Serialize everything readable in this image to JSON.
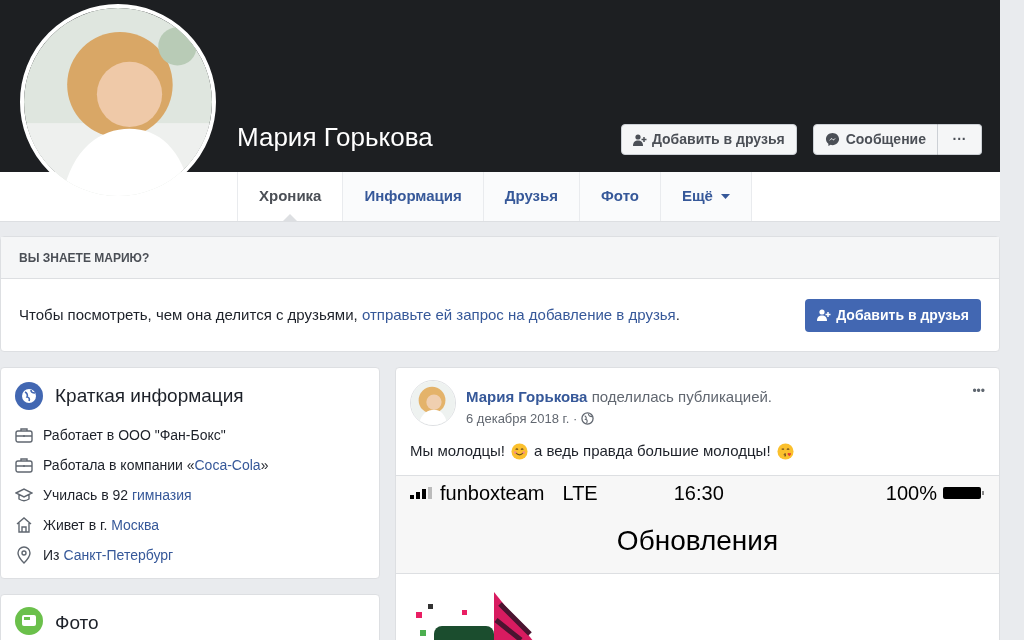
{
  "profile": {
    "name": "Мария Горькова",
    "add_friend": "Добавить в друзья",
    "message": "Сообщение",
    "more": "···"
  },
  "tabs": [
    {
      "label": "Хроника",
      "selected": true
    },
    {
      "label": "Информация",
      "selected": false
    },
    {
      "label": "Друзья",
      "selected": false
    },
    {
      "label": "Фото",
      "selected": false
    },
    {
      "label": "Ещё",
      "selected": false,
      "dropdown": true
    }
  ],
  "prompt": {
    "title": "ВЫ ЗНАЕТЕ МАРИЮ?",
    "text": "Чтобы посмотреть, чем она делится с друзьями,",
    "link": "отправьте ей запрос на добавление в друзья",
    "after": ".",
    "button": "Добавить в друзья"
  },
  "intro": {
    "title": "Краткая информация",
    "items": [
      {
        "kind": "work",
        "text": "Работает в ООО \"Фан-Бокс\""
      },
      {
        "kind": "work",
        "text": "Работала в компании «",
        "link": "Coca-Cola",
        "after": "»"
      },
      {
        "kind": "school",
        "text": "Училась в 92 ",
        "link": "гимназия"
      },
      {
        "kind": "home",
        "text": "Живет в г. ",
        "link": "Москва"
      },
      {
        "kind": "place",
        "text": "Из ",
        "link": "Санкт-Петербург"
      }
    ]
  },
  "photos": {
    "title": "Фото"
  },
  "post": {
    "author": "Мария Горькова",
    "action": "поделилась публикацией.",
    "date": "6 декабря 2018 г. ·",
    "more": "•••",
    "text_1": "Мы молодцы!",
    "text_2": "а ведь правда большие молодцы!",
    "shared": {
      "carrier": "funboxteam",
      "network": "LTE",
      "time": "16:30",
      "battery": "100%",
      "title": "Обновления"
    }
  }
}
